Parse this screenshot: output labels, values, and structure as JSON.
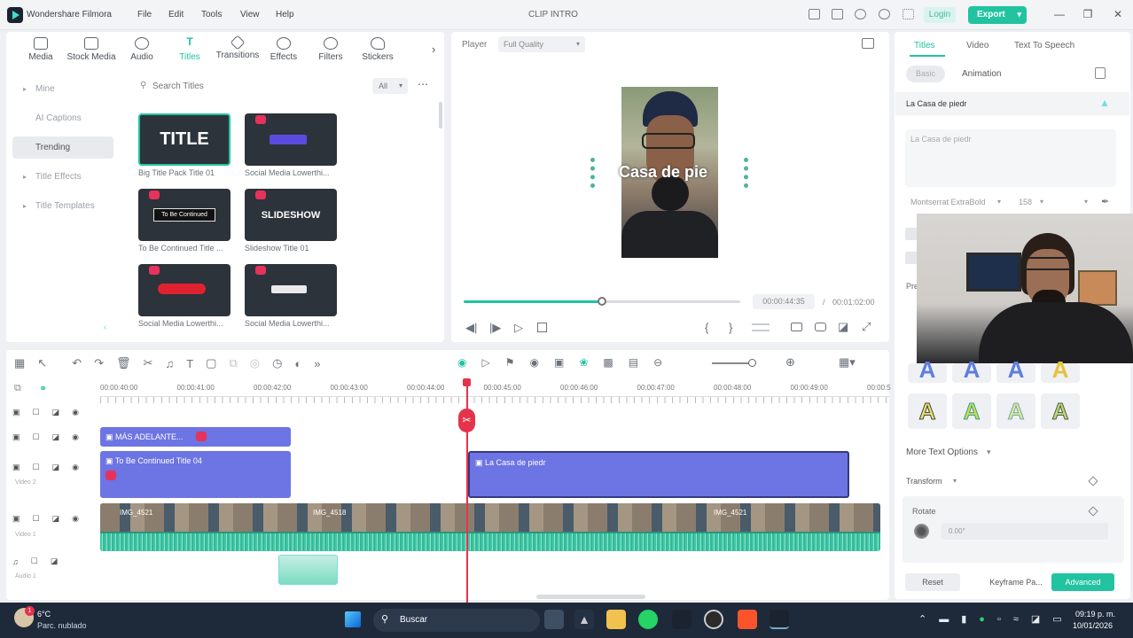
{
  "app": {
    "name": "Wondershare Filmora",
    "project_title": "CLIP INTRO"
  },
  "menu": [
    "File",
    "Edit",
    "Tools",
    "View",
    "Help"
  ],
  "header": {
    "login": "Login",
    "export": "Export"
  },
  "media_tabs": [
    "Media",
    "Stock Media",
    "Audio",
    "Titles",
    "Transitions",
    "Effects",
    "Filters",
    "Stickers"
  ],
  "active_media_tab": "Titles",
  "sidebar": [
    "Mine",
    "AI Captions",
    "Trending",
    "Title Effects",
    "Title Templates"
  ],
  "search": {
    "placeholder": "Search Titles",
    "filter": "All"
  },
  "thumbs": [
    {
      "label": "Big Title Pack Title 01",
      "text": "TITLE",
      "premium": false
    },
    {
      "label": "Social Media Lowerthi...",
      "text": "",
      "premium": true
    },
    {
      "label": "To Be Continued Title ...",
      "text": "To Be Continued",
      "premium": true
    },
    {
      "label": "Slideshow Title 01",
      "text": "SLIDESHOW",
      "premium": true
    },
    {
      "label": "Social Media Lowerthi...",
      "text": "",
      "premium": true
    },
    {
      "label": "Social Media Lowerthi...",
      "text": "",
      "premium": true
    }
  ],
  "player": {
    "label": "Player",
    "quality": "Full Quality",
    "overlay_text": "Casa de pie",
    "current_time": "00:00:44:35",
    "total_time": "00:01:02:00",
    "progress": 0.5
  },
  "timeline": {
    "ruler": [
      "00:00:40:00",
      "00:00:41:00",
      "00:00:42:00",
      "00:00:43:00",
      "00:00:44:00",
      "00:00:45:00",
      "00:00:46:00",
      "00:00:47:00",
      "00:00:48:00",
      "00:00:49:00",
      "00:00:5"
    ],
    "clips": {
      "mas": "MÁS ADELANTE...",
      "tbc": "To Be Continued Title 04",
      "casa": "La Casa de piedr"
    },
    "track_names": {
      "video2": "Video 2",
      "video1": "Video 1",
      "audio1": "Audio 1"
    },
    "video_clip_labels": [
      "IMG_4521",
      "IMG_4518",
      "IMG_4521"
    ]
  },
  "right_panel": {
    "tabs": [
      "Titles",
      "Video",
      "Text To Speech"
    ],
    "subtabs": [
      "Basic",
      "Animation"
    ],
    "layer_name": "La Casa de piedr",
    "text_value": "La Casa de piedr",
    "font": "Montserrat ExtraBold",
    "font_size": "158",
    "pre_label": "Pre",
    "more_text": "More Text Options",
    "transform": "Transform",
    "rotate": "Rotate",
    "rotate_value": "0.00°",
    "reset": "Reset",
    "keyframe": "Keyframe Pa...",
    "advanced": "Advanced"
  },
  "taskbar": {
    "temp": "6°C",
    "weather": "Parc. nublado",
    "search": "Buscar",
    "time": "09:19 p. m.",
    "date": "10/01/2026"
  }
}
